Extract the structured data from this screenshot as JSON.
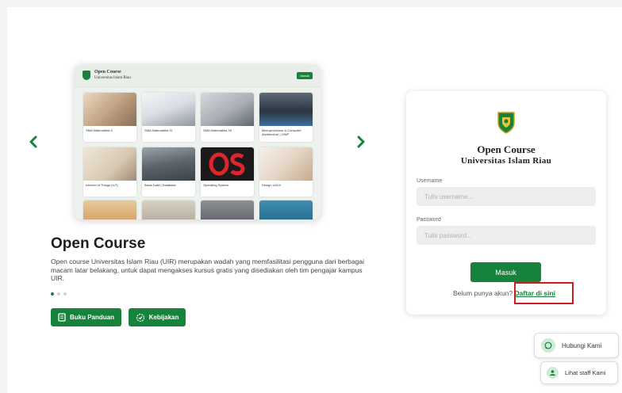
{
  "preview": {
    "header_title": "Open Course",
    "header_subtitle": "Universitas Islam Riau",
    "header_button": "Masuk",
    "courses": [
      {
        "caption": "SMA Matematika X"
      },
      {
        "caption": "SMA Matematika XI"
      },
      {
        "caption": "SMA Matematika XII"
      },
      {
        "caption": "Microprocessor & Computer Architecture | OWP"
      },
      {
        "caption": "Internet of Things (IoT)"
      },
      {
        "caption": "Basis Data | Database"
      },
      {
        "caption": "Operating System"
      },
      {
        "caption": "Design UI/UX"
      }
    ]
  },
  "hero": {
    "title": "Open Course",
    "description": "Open course Universitas Islam Riau (UIR) merupakan wadah yang memfasilitasi pengguna dari berbagai macam latar belakang, untuk dapat mengakses kursus gratis yang disediakan oleh tim pengajar kampus UIR.",
    "button_guide": "Buku Panduan",
    "button_policy": "Kebijakan"
  },
  "login": {
    "title": "Open Course",
    "subtitle": "Universitas Islam Riau",
    "username_label": "Username",
    "username_placeholder": "Tulis username...",
    "password_label": "Password",
    "password_placeholder": "Tulis password...",
    "submit": "Masuk",
    "signup_prompt": "Belum punya akun?",
    "signup_link": "Daftar di sini"
  },
  "floating": {
    "contact": "Hubungi Kami",
    "staff": "Lihat staff Kami"
  },
  "colors": {
    "primary": "#17823b",
    "highlight": "#cc1f1f"
  }
}
